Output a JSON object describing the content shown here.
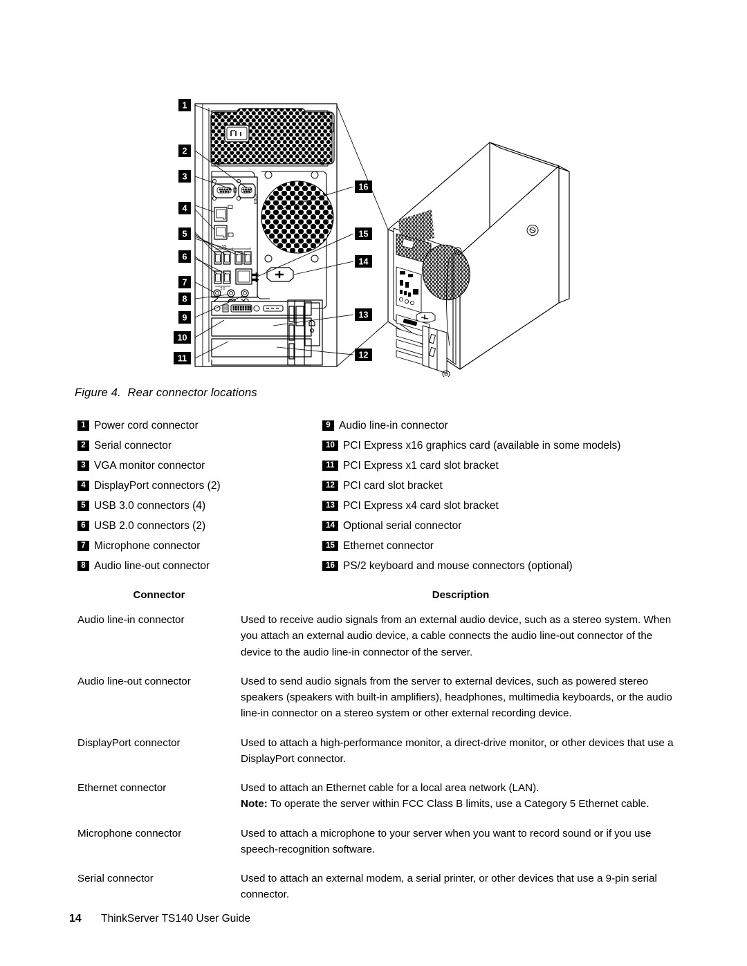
{
  "figure": {
    "caption": "Figure 4.  Rear connector locations",
    "illustration_name": "rear-connector-locations-illustration",
    "callouts_left": [
      "1",
      "2",
      "3",
      "4",
      "5",
      "6",
      "7",
      "8",
      "9",
      "10",
      "11"
    ],
    "callouts_right": [
      "16",
      "15",
      "14",
      "13",
      "12"
    ]
  },
  "legend": {
    "left": [
      {
        "num": "1",
        "label": "Power cord connector"
      },
      {
        "num": "2",
        "label": "Serial connector"
      },
      {
        "num": "3",
        "label": "VGA monitor connector"
      },
      {
        "num": "4",
        "label": "DisplayPort connectors (2)"
      },
      {
        "num": "5",
        "label": "USB 3.0 connectors (4)"
      },
      {
        "num": "6",
        "label": "USB 2.0 connectors (2)"
      },
      {
        "num": "7",
        "label": "Microphone connector"
      },
      {
        "num": "8",
        "label": "Audio line-out connector"
      }
    ],
    "right": [
      {
        "num": "9",
        "label": "Audio line-in connector"
      },
      {
        "num": "10",
        "label": "PCI Express x16 graphics card (available in some models)"
      },
      {
        "num": "11",
        "label": "PCI Express x1 card slot bracket"
      },
      {
        "num": "12",
        "label": "PCI card slot bracket"
      },
      {
        "num": "13",
        "label": "PCI Express x4 card slot bracket"
      },
      {
        "num": "14",
        "label": "Optional serial connector"
      },
      {
        "num": "15",
        "label": "Ethernet connector"
      },
      {
        "num": "16",
        "label": "PS/2 keyboard and mouse connectors (optional)"
      }
    ]
  },
  "table": {
    "headers": {
      "connector": "Connector",
      "description": "Description"
    },
    "rows": [
      {
        "connector": "Audio line-in connector",
        "description": "Used to receive audio signals from an external audio device, such as a stereo system. When you attach an external audio device, a cable connects the audio line-out connector of the device to the audio line-in connector of the server."
      },
      {
        "connector": "Audio line-out connector",
        "description": "Used to send audio signals from the server to external devices, such as powered stereo speakers (speakers with built-in amplifiers), headphones, multimedia keyboards, or the audio line-in connector on a stereo system or other external recording device."
      },
      {
        "connector": "DisplayPort connector",
        "description": "Used to attach a high-performance monitor, a direct-drive monitor, or other devices that use a DisplayPort connector."
      },
      {
        "connector": "Ethernet connector",
        "description": "Used to attach an Ethernet cable for a local area network (LAN).",
        "note_label": "Note:",
        "note_text": " To operate the server within FCC Class B limits, use a Category 5 Ethernet cable."
      },
      {
        "connector": "Microphone connector",
        "description": "Used to attach a microphone to your server when you want to record sound or if you use speech-recognition software."
      },
      {
        "connector": "Serial connector",
        "description": "Used to attach an external modem, a serial printer, or other devices that use a 9-pin serial connector."
      }
    ]
  },
  "footer": {
    "page_number": "14",
    "title": "ThinkServer TS140 User Guide"
  },
  "colors": {
    "ink": "#000000",
    "paper": "#ffffff"
  }
}
